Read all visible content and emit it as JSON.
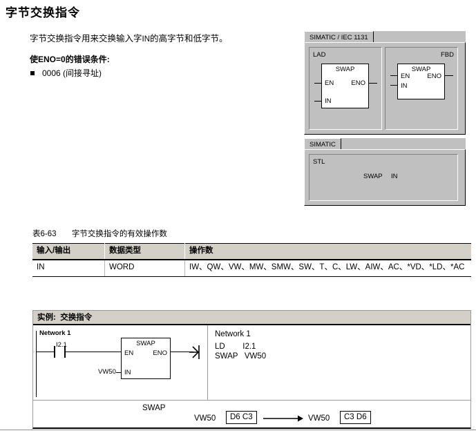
{
  "page": {
    "title": "字节交换指令"
  },
  "intro": {
    "paragraph_part1": "字节交换指令用来交换输入字",
    "paragraph_inline": "IN",
    "paragraph_part2": "的高字节和低字节。",
    "error_heading_prefix": "使",
    "error_heading_code": "ENO=0",
    "error_heading_suffix": "的错误条件:",
    "errors": [
      {
        "label": "0006 (间接寻址)"
      }
    ]
  },
  "iec_panel": {
    "tab_label": "SIMATIC / IEC 1131",
    "lad": {
      "corner_label": "LAD",
      "block_title": "SWAP",
      "pin_en": "EN",
      "pin_eno": "ENO",
      "pin_in": "IN"
    },
    "fbd": {
      "corner_label": "FBD",
      "block_title": "SWAP",
      "pin_en": "EN",
      "pin_eno": "ENO",
      "pin_in": "IN"
    }
  },
  "stl_panel": {
    "tab_label": "SIMATIC",
    "corner_label": "STL",
    "instruction": "SWAP",
    "operand": "IN"
  },
  "table": {
    "caption_number": "表6-63",
    "caption_text": "字节交换指令的有效操作数",
    "columns": [
      "输入/输出",
      "数据类型",
      "操作数"
    ],
    "rows": [
      {
        "io": "IN",
        "datatype": "WORD",
        "operands": "IW、QW、VW、MW、SMW、SW、T、C、LW、AIW、AC、*VD、*LD、*AC"
      }
    ]
  },
  "example": {
    "header_label": "实例:  交换指令",
    "lad": {
      "network_label": "Network 1",
      "contact_label": "I2.1",
      "block_title": "SWAP",
      "pin_en": "EN",
      "pin_eno": "ENO",
      "pin_in": "IN",
      "input_operand": "VW50"
    },
    "stl": {
      "network_label": "Network 1",
      "code": "LD        I2.1\nSWAP   VW50"
    },
    "result": {
      "instruction": "SWAP",
      "source_label": "VW50",
      "source_value": "D6 C3",
      "dest_label": "VW50",
      "dest_value": "C3 D6"
    }
  },
  "colors": {
    "panel_face": "#c0c0c0",
    "table_header": "#d4d0c8",
    "rule": "#000000"
  }
}
